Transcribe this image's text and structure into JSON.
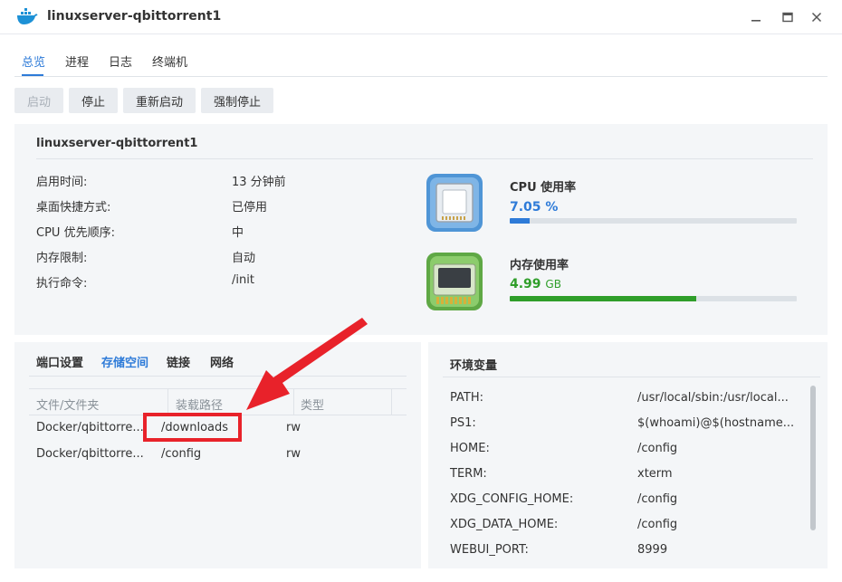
{
  "window": {
    "title": "linuxserver-qbittorrent1"
  },
  "tabs": [
    {
      "label": "总览"
    },
    {
      "label": "进程"
    },
    {
      "label": "日志"
    },
    {
      "label": "终端机"
    }
  ],
  "toolbar": {
    "start": "启动",
    "stop": "停止",
    "restart": "重新启动",
    "force_stop": "强制停止"
  },
  "info": {
    "title": "linuxserver-qbittorrent1",
    "rows": [
      {
        "label": "启用时间:",
        "value": "13 分钟前"
      },
      {
        "label": "桌面快捷方式:",
        "value": "已停用"
      },
      {
        "label": "CPU 优先顺序:",
        "value": "中"
      },
      {
        "label": "内存限制:",
        "value": "自动"
      },
      {
        "label": "执行命令:",
        "value": "/init"
      }
    ]
  },
  "resources": {
    "cpu": {
      "label": "CPU 使用率",
      "value": "7.05",
      "unit": "%",
      "fraction": 0.07,
      "color": "#2e7bd8"
    },
    "memory": {
      "label": "内存使用率",
      "value": "4.99",
      "unit": "GB",
      "fraction": 0.65,
      "color": "#2f9e2a"
    }
  },
  "storage": {
    "tabs": [
      {
        "label": "端口设置"
      },
      {
        "label": "存储空间"
      },
      {
        "label": "链接"
      },
      {
        "label": "网络"
      }
    ],
    "columns": [
      "文件/文件夹",
      "装载路径",
      "类型"
    ],
    "rows": [
      {
        "folder": "Docker/qbittorre...",
        "mount": "/downloads",
        "type": "rw"
      },
      {
        "folder": "Docker/qbittorre...",
        "mount": "/config",
        "type": "rw"
      }
    ]
  },
  "env": {
    "title": "环境变量",
    "rows": [
      {
        "name": "PATH:",
        "value": "/usr/local/sbin:/usr/local..."
      },
      {
        "name": "PS1:",
        "value": "$(whoami)@$(hostname..."
      },
      {
        "name": "HOME:",
        "value": "/config"
      },
      {
        "name": "TERM:",
        "value": "xterm"
      },
      {
        "name": "XDG_CONFIG_HOME:",
        "value": "/config"
      },
      {
        "name": "XDG_DATA_HOME:",
        "value": "/config"
      },
      {
        "name": "WEBUI_PORT:",
        "value": "8999"
      }
    ]
  },
  "annotation": {
    "color": "#e8222a"
  }
}
